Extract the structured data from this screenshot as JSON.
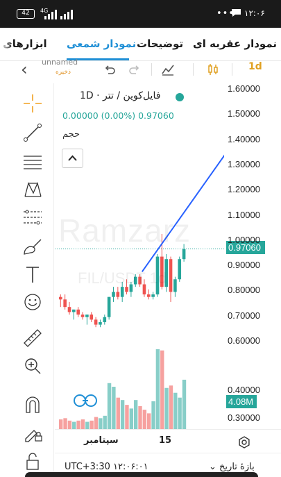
{
  "status_bar": {
    "battery": "42",
    "network": "4G",
    "more": "•••",
    "time": "۱۲:۰۶"
  },
  "tabs": [
    {
      "label": "نمودار عقربه ای",
      "active": false
    },
    {
      "label": "توضیحات",
      "active": false
    },
    {
      "label": "نمودار شمعی",
      "active": true
    },
    {
      "label": "ابزارهای",
      "active": false
    }
  ],
  "toolbar": {
    "layout_name": "unnamed",
    "saved_label": "ذخیره",
    "interval": "1d",
    "icons": [
      "back-icon",
      "undo-icon",
      "redo-icon",
      "indicators-icon",
      "candle-type-icon"
    ]
  },
  "legend": {
    "title": "فایل‌کوین / تتر · 1D",
    "values": "0.00000 (0.00%)  0.97060",
    "volume_label": "حجم",
    "status_color": "#26a69a"
  },
  "watermark": {
    "brand": "Ramzarz",
    "symbol": "FIL/USDT 1d"
  },
  "price_axis": {
    "ticks": [
      "1.60000",
      "1.50000",
      "1.40000",
      "1.30000",
      "1.20000",
      "1.10000",
      "1.00000",
      "0.90000",
      "0.80000",
      "0.70000",
      "0.60000",
      "0.40000",
      "0.30000"
    ],
    "last_price": "0.97060",
    "last_volume": "4.08M"
  },
  "time_axis": {
    "month_label": "سپتامبر",
    "day_label": "15"
  },
  "bottom_bar": {
    "clock": "UTC+3:30  ۱۲:۰۶:۰۱",
    "range_label": "بازهٔ تاریخ"
  },
  "colors": {
    "up": "#26a69a",
    "down": "#ef5350",
    "trendline": "#2962ff",
    "tab_active": "#1f8fd6"
  },
  "chart_data": {
    "type": "candlestick",
    "ylim": [
      0.6,
      1.65
    ],
    "candles": [
      {
        "o": 0.78,
        "h": 0.79,
        "l": 0.74,
        "c": 0.77
      },
      {
        "o": 0.77,
        "h": 0.79,
        "l": 0.73,
        "c": 0.74
      },
      {
        "o": 0.74,
        "h": 0.76,
        "l": 0.71,
        "c": 0.72
      },
      {
        "o": 0.72,
        "h": 0.73,
        "l": 0.69,
        "c": 0.73
      },
      {
        "o": 0.73,
        "h": 0.74,
        "l": 0.7,
        "c": 0.71
      },
      {
        "o": 0.71,
        "h": 0.72,
        "l": 0.69,
        "c": 0.7
      },
      {
        "o": 0.7,
        "h": 0.71,
        "l": 0.67,
        "c": 0.71
      },
      {
        "o": 0.71,
        "h": 0.72,
        "l": 0.68,
        "c": 0.69
      },
      {
        "o": 0.69,
        "h": 0.7,
        "l": 0.66,
        "c": 0.67
      },
      {
        "o": 0.67,
        "h": 0.69,
        "l": 0.66,
        "c": 0.68
      },
      {
        "o": 0.68,
        "h": 0.71,
        "l": 0.67,
        "c": 0.7
      },
      {
        "o": 0.7,
        "h": 0.78,
        "l": 0.69,
        "c": 0.78
      },
      {
        "o": 0.78,
        "h": 0.82,
        "l": 0.76,
        "c": 0.8
      },
      {
        "o": 0.8,
        "h": 0.82,
        "l": 0.77,
        "c": 0.78
      },
      {
        "o": 0.78,
        "h": 0.84,
        "l": 0.76,
        "c": 0.82
      },
      {
        "o": 0.82,
        "h": 0.85,
        "l": 0.79,
        "c": 0.8
      },
      {
        "o": 0.8,
        "h": 0.84,
        "l": 0.78,
        "c": 0.83
      },
      {
        "o": 0.83,
        "h": 0.87,
        "l": 0.82,
        "c": 0.86
      },
      {
        "o": 0.86,
        "h": 0.87,
        "l": 0.82,
        "c": 0.83
      },
      {
        "o": 0.83,
        "h": 0.85,
        "l": 0.78,
        "c": 0.79
      },
      {
        "o": 0.79,
        "h": 0.81,
        "l": 0.77,
        "c": 0.78
      },
      {
        "o": 0.78,
        "h": 0.8,
        "l": 0.77,
        "c": 0.79
      },
      {
        "o": 0.79,
        "h": 0.95,
        "l": 0.78,
        "c": 0.94
      },
      {
        "o": 0.94,
        "h": 1.03,
        "l": 0.81,
        "c": 0.82
      },
      {
        "o": 0.82,
        "h": 0.95,
        "l": 0.8,
        "c": 0.93
      },
      {
        "o": 0.93,
        "h": 0.94,
        "l": 0.76,
        "c": 0.8
      },
      {
        "o": 0.8,
        "h": 0.86,
        "l": 0.78,
        "c": 0.85
      },
      {
        "o": 0.85,
        "h": 0.94,
        "l": 0.84,
        "c": 0.93
      },
      {
        "o": 0.93,
        "h": 0.99,
        "l": 0.92,
        "c": 0.97
      }
    ],
    "volumes": [
      0.8,
      0.9,
      0.7,
      0.6,
      0.7,
      0.8,
      0.6,
      0.7,
      1.0,
      0.9,
      1.1,
      3.8,
      3.5,
      2.6,
      2.4,
      2.0,
      1.7,
      2.4,
      1.9,
      1.6,
      1.3,
      2.3,
      6.6,
      6.5,
      3.4,
      3.6,
      3.0,
      2.6,
      4.08
    ],
    "volume_max": 7.0,
    "trendline": [
      {
        "i": 18.5,
        "price": 0.88
      },
      {
        "i": 44,
        "price": 1.51
      }
    ],
    "last_price": 0.9706
  }
}
